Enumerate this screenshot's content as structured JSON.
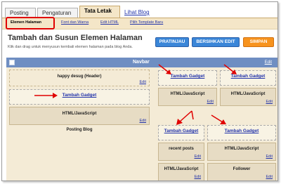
{
  "tabs": [
    {
      "label": "Posting"
    },
    {
      "label": "Pengaturan"
    },
    {
      "label": "Tata Letak"
    }
  ],
  "tab_link": {
    "label": "Lihat Blog"
  },
  "subtabs": [
    {
      "label": "Elemen Halaman"
    },
    {
      "label": "Font dan Warna"
    },
    {
      "label": "Edit HTML"
    },
    {
      "label": "Pilih Template Baru"
    }
  ],
  "page": {
    "title": "Tambah dan Susun Elemen Halaman",
    "description": "Klik dan drag untuk menyusun kembali elemen halaman pada blog Anda."
  },
  "buttons": {
    "preview": "PRATINJAU",
    "clear_edits": "BERSIHKAN EDIT",
    "save": "SIMPAN"
  },
  "layout": {
    "navbar": {
      "label": "Navbar",
      "edit": "Edit"
    },
    "header": {
      "label": "happy desug (Header)",
      "edit": "Edit"
    },
    "add_gadget_label": "Tambah Gadget",
    "main_html": {
      "label": "HTML/JavaScript",
      "edit": "Edit"
    },
    "blog_posts": {
      "label": "Posting Blog"
    },
    "side1_html": {
      "label": "HTML/JavaScript",
      "edit": "Edit"
    },
    "side2_html": {
      "label": "HTML/JavaScript",
      "edit": "Edit"
    },
    "recent_posts": {
      "label": "recent posts",
      "edit": "Edit"
    },
    "side3_html": {
      "label": "HTML/JavaScript",
      "edit": "Edit"
    },
    "side4_html": {
      "label": "HTML/JavaScript",
      "edit": "Edit"
    },
    "follower": {
      "label": "Follower",
      "edit": "Edit"
    }
  },
  "colors": {
    "accent_red": "#e00000",
    "navbar": "#6f8ec2",
    "save_orange": "#f7931e",
    "button_blue": "#3a86d8"
  }
}
